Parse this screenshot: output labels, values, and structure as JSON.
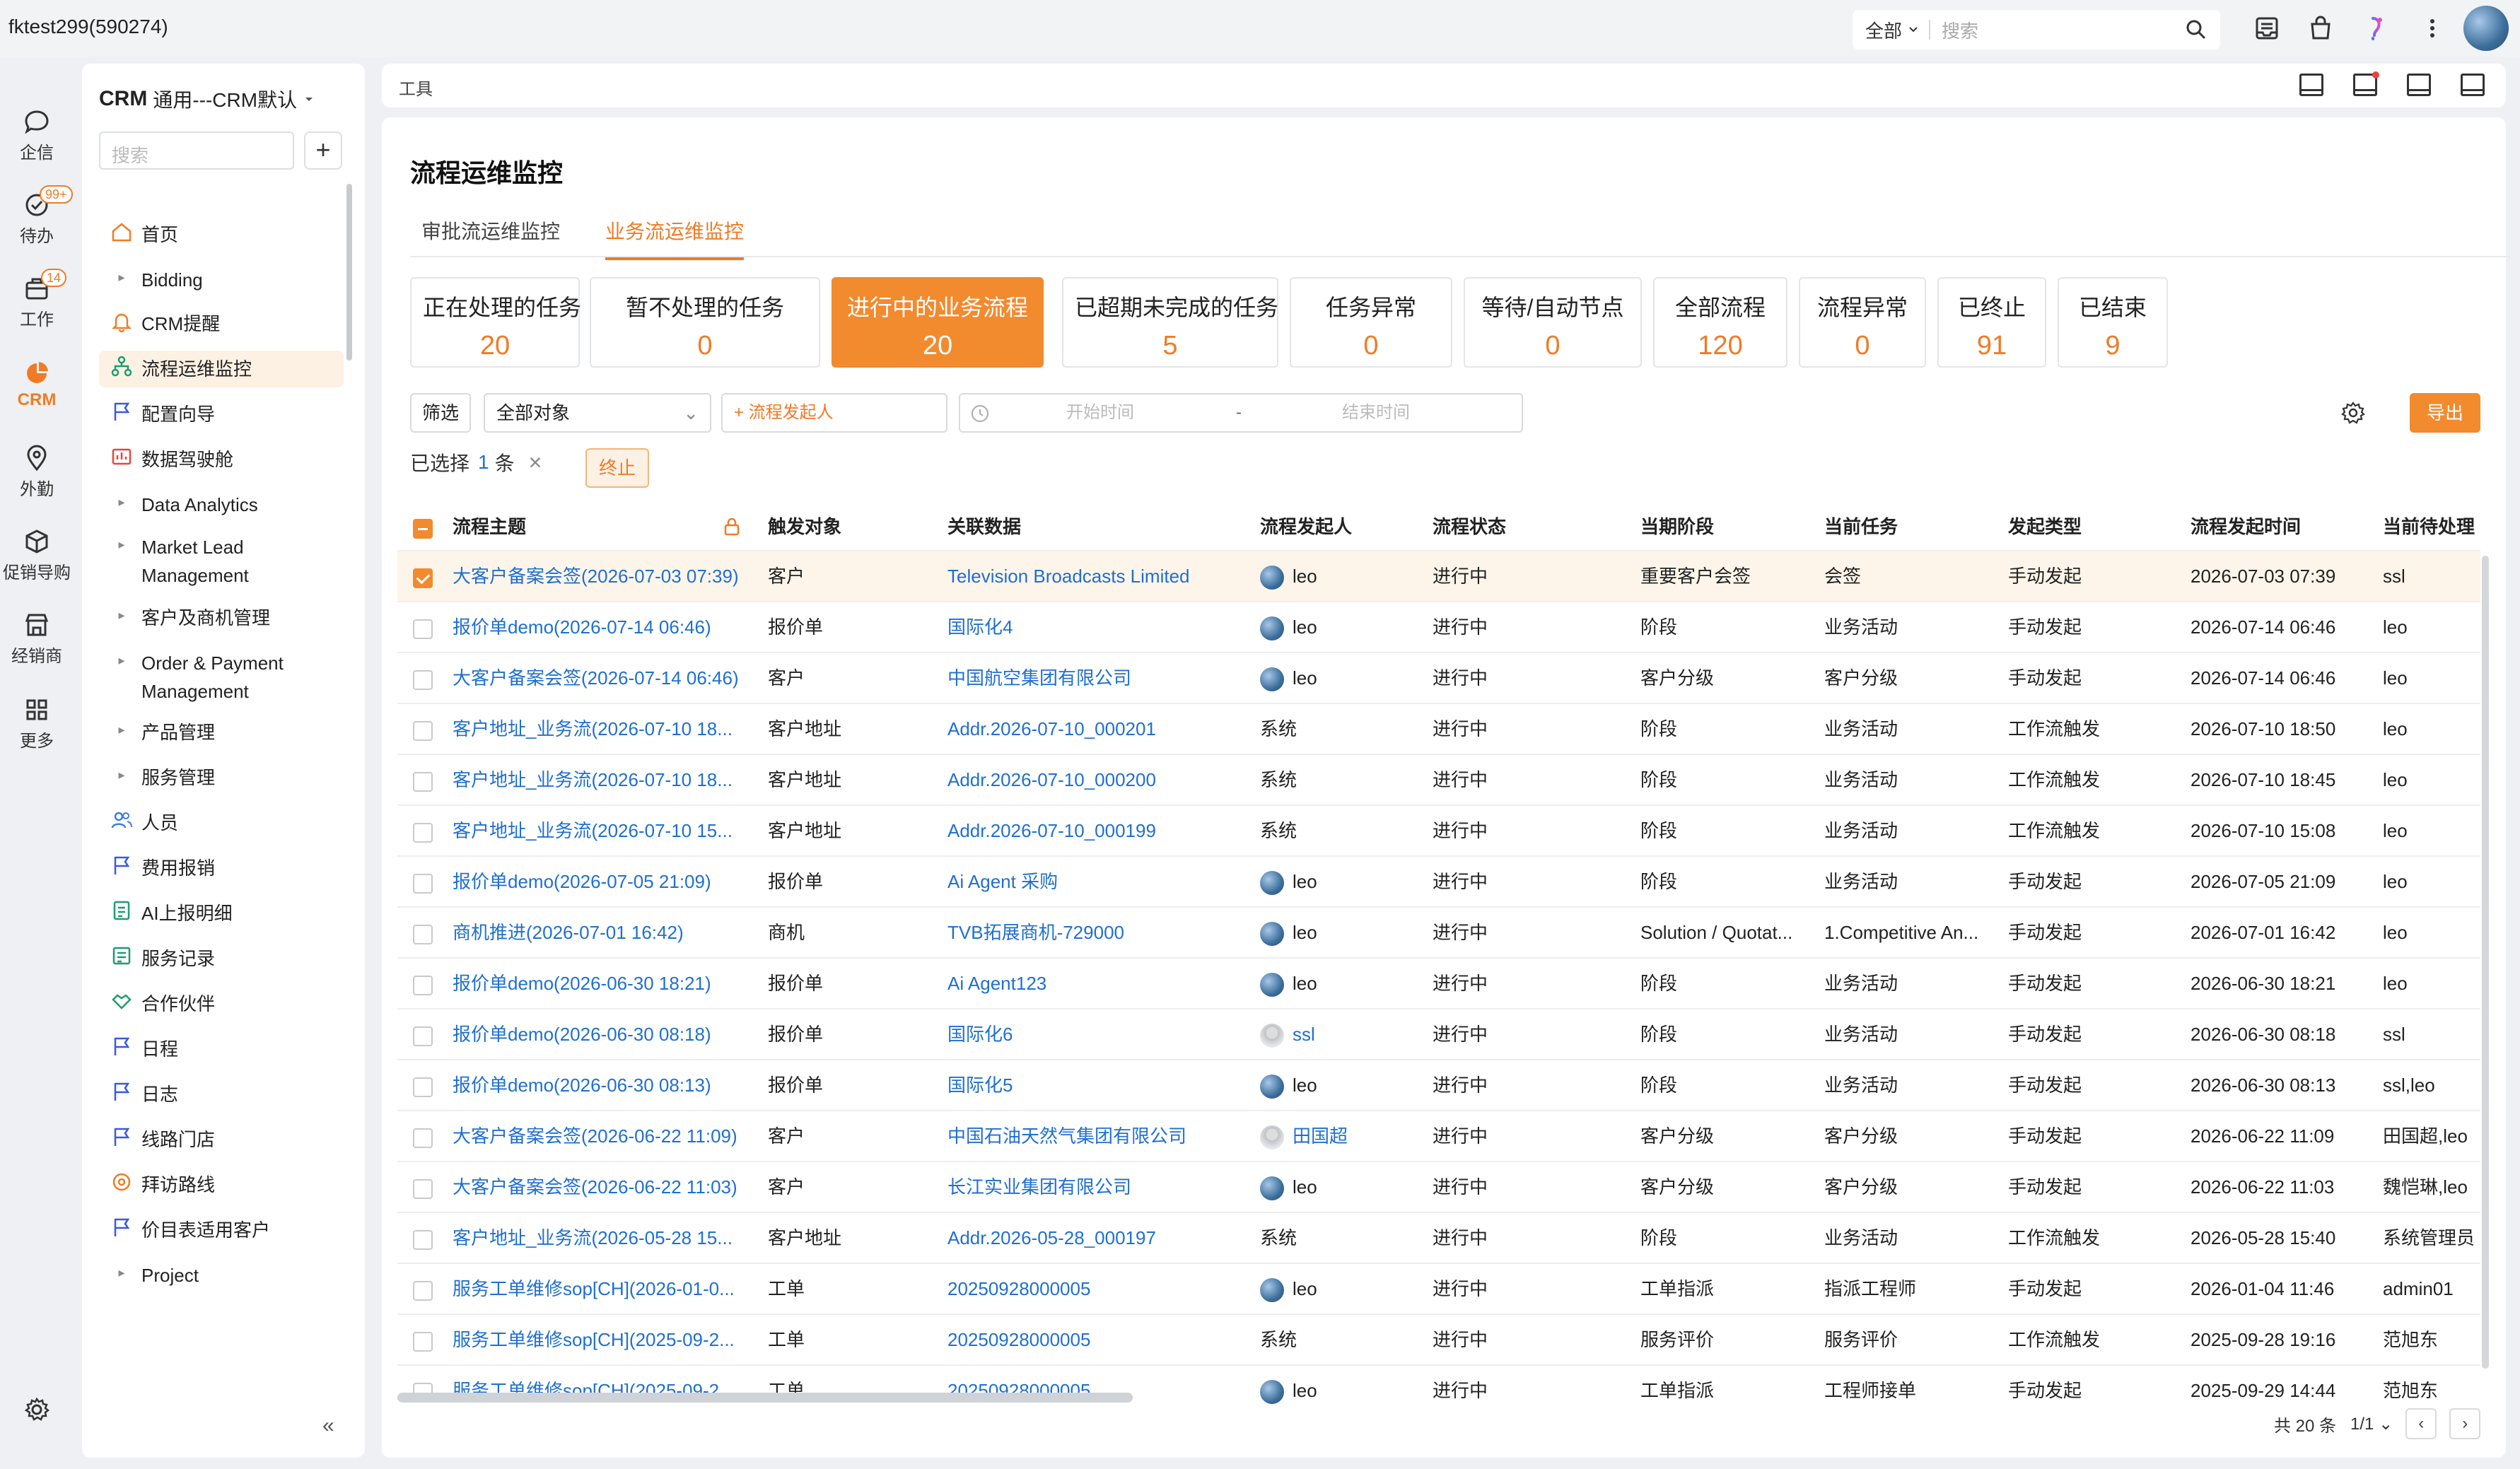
{
  "topbar": {
    "account": "fktest299(590274)",
    "search_scope": "全部",
    "search_placeholder": "搜索"
  },
  "rail": {
    "items": [
      {
        "label": "企信",
        "icon": "chat-icon"
      },
      {
        "label": "待办",
        "icon": "todo-check-icon",
        "badge": "99+"
      },
      {
        "label": "工作",
        "icon": "briefcase-icon",
        "badge": "14"
      },
      {
        "label": "CRM",
        "icon": "crm-pie-icon"
      },
      {
        "label": "外勤",
        "icon": "location-icon"
      },
      {
        "label": "促销导购",
        "icon": "box-icon"
      },
      {
        "label": "经销商",
        "icon": "store-icon"
      },
      {
        "label": "更多",
        "icon": "grid-icon"
      }
    ]
  },
  "nav": {
    "title_bold": "CRM",
    "title_rest": "通用---CRM默认",
    "search_placeholder": "搜索",
    "add_label": "+",
    "items": [
      {
        "label": "首页",
        "type": "icon",
        "icon": "home-icon"
      },
      {
        "label": "Bidding",
        "type": "group"
      },
      {
        "label": "CRM提醒",
        "type": "icon",
        "icon": "bell-icon"
      },
      {
        "label": "流程运维监控",
        "type": "icon",
        "icon": "flow-icon",
        "active": true
      },
      {
        "label": "配置向导",
        "type": "icon",
        "icon": "flag-icon"
      },
      {
        "label": "数据驾驶舱",
        "type": "icon",
        "icon": "dashboard-icon"
      },
      {
        "label": "Data Analytics",
        "type": "group"
      },
      {
        "label": "Market Lead Management",
        "type": "group"
      },
      {
        "label": "客户及商机管理",
        "type": "group"
      },
      {
        "label": "Order & Payment Management",
        "type": "group"
      },
      {
        "label": "产品管理",
        "type": "group"
      },
      {
        "label": "服务管理",
        "type": "group"
      },
      {
        "label": "人员",
        "type": "icon",
        "icon": "people-icon"
      },
      {
        "label": "费用报销",
        "type": "icon",
        "icon": "flag-icon"
      },
      {
        "label": "AI上报明细",
        "type": "icon",
        "icon": "report-icon"
      },
      {
        "label": "服务记录",
        "type": "icon",
        "icon": "record-icon"
      },
      {
        "label": "合作伙伴",
        "type": "icon",
        "icon": "handshake-icon"
      },
      {
        "label": "日程",
        "type": "icon",
        "icon": "flag-icon"
      },
      {
        "label": "日志",
        "type": "icon",
        "icon": "flag-icon"
      },
      {
        "label": "线路门店",
        "type": "icon",
        "icon": "flag-icon"
      },
      {
        "label": "拜访路线",
        "type": "icon",
        "icon": "route-icon"
      },
      {
        "label": "价目表适用客户",
        "type": "icon",
        "icon": "flag-icon"
      },
      {
        "label": "Project",
        "type": "group"
      }
    ],
    "collapse_label": "«"
  },
  "toolstrip": {
    "label": "工具"
  },
  "page": {
    "title": "流程运维监控",
    "tabs": [
      "审批流运维监控",
      "业务流运维监控"
    ],
    "active_tab": 1
  },
  "stats": [
    {
      "label": "正在处理的任务",
      "value": "20"
    },
    {
      "label": "暂不处理的任务",
      "value": "0"
    },
    {
      "label": "进行中的业务流程",
      "value": "20",
      "active": true
    },
    {
      "label": "已超期未完成的任务",
      "value": "5"
    },
    {
      "label": "任务异常",
      "value": "0"
    },
    {
      "label": "等待/自动节点",
      "value": "0"
    },
    {
      "label": "全部流程",
      "value": "120"
    },
    {
      "label": "流程异常",
      "value": "0"
    },
    {
      "label": "已终止",
      "value": "91"
    },
    {
      "label": "已结束",
      "value": "9"
    }
  ],
  "filters": {
    "filter_label": "筛选",
    "object_value": "全部对象",
    "initiator_placeholder": "+ 流程发起人",
    "start_placeholder": "开始时间",
    "range_sep": "-",
    "end_placeholder": "结束时间",
    "export_label": "导出"
  },
  "selection": {
    "prefix": "已选择",
    "count": "1",
    "suffix": "条",
    "clear": "×",
    "terminate_label": "终止"
  },
  "table": {
    "columns": [
      "流程主题",
      "触发对象",
      "关联数据",
      "流程发起人",
      "流程状态",
      "当期阶段",
      "当前任务",
      "发起类型",
      "流程发起时间",
      "当前待处理"
    ],
    "rows": [
      {
        "checked": true,
        "subject": "大客户备案会签(2026-07-03 07:39)",
        "object": "客户",
        "related": "Television Broadcasts Limited",
        "initiator": "leo",
        "avatar": "photo",
        "status": "进行中",
        "stage": "重要客户会签",
        "task": "会签",
        "type": "手动发起",
        "time": "2026-07-03 07:39",
        "pending": "ssl"
      },
      {
        "checked": false,
        "subject": "报价单demo(2026-07-14 06:46)",
        "object": "报价单",
        "related": "国际化4",
        "initiator": "leo",
        "avatar": "photo",
        "status": "进行中",
        "stage": "阶段",
        "task": "业务活动",
        "type": "手动发起",
        "time": "2026-07-14 06:46",
        "pending": "leo"
      },
      {
        "checked": false,
        "subject": "大客户备案会签(2026-07-14 06:46)",
        "object": "客户",
        "related": "中国航空集团有限公司",
        "initiator": "leo",
        "avatar": "photo",
        "status": "进行中",
        "stage": "客户分级",
        "task": "客户分级",
        "type": "手动发起",
        "time": "2026-07-14 06:46",
        "pending": "leo"
      },
      {
        "checked": false,
        "subject": "客户地址_业务流(2026-07-10 18...",
        "object": "客户地址",
        "related": "Addr.2026-07-10_000201",
        "initiator": "系统",
        "avatar": "none",
        "status": "进行中",
        "stage": "阶段",
        "task": "业务活动",
        "type": "工作流触发",
        "time": "2026-07-10 18:50",
        "pending": "leo"
      },
      {
        "checked": false,
        "subject": "客户地址_业务流(2026-07-10 18...",
        "object": "客户地址",
        "related": "Addr.2026-07-10_000200",
        "initiator": "系统",
        "avatar": "none",
        "status": "进行中",
        "stage": "阶段",
        "task": "业务活动",
        "type": "工作流触发",
        "time": "2026-07-10 18:45",
        "pending": "leo"
      },
      {
        "checked": false,
        "subject": "客户地址_业务流(2026-07-10 15...",
        "object": "客户地址",
        "related": "Addr.2026-07-10_000199",
        "initiator": "系统",
        "avatar": "none",
        "status": "进行中",
        "stage": "阶段",
        "task": "业务活动",
        "type": "工作流触发",
        "time": "2026-07-10 15:08",
        "pending": "leo"
      },
      {
        "checked": false,
        "subject": "报价单demo(2026-07-05 21:09)",
        "object": "报价单",
        "related": "Ai Agent 采购",
        "initiator": "leo",
        "avatar": "photo",
        "status": "进行中",
        "stage": "阶段",
        "task": "业务活动",
        "type": "手动发起",
        "time": "2026-07-05 21:09",
        "pending": "leo"
      },
      {
        "checked": false,
        "subject": "商机推进(2026-07-01 16:42)",
        "object": "商机",
        "related": "TVB拓展商机-729000",
        "initiator": "leo",
        "avatar": "photo",
        "status": "进行中",
        "stage": "Solution / Quotat...",
        "task": "1.Competitive An...",
        "type": "手动发起",
        "time": "2026-07-01 16:42",
        "pending": "leo"
      },
      {
        "checked": false,
        "subject": "报价单demo(2026-06-30 18:21)",
        "object": "报价单",
        "related": "Ai Agent123",
        "initiator": "leo",
        "avatar": "photo",
        "status": "进行中",
        "stage": "阶段",
        "task": "业务活动",
        "type": "手动发起",
        "time": "2026-06-30 18:21",
        "pending": "leo"
      },
      {
        "checked": false,
        "subject": "报价单demo(2026-06-30 08:18)",
        "object": "报价单",
        "related": "国际化6",
        "initiator": "ssl",
        "avatar": "gray",
        "initiator_link": true,
        "status": "进行中",
        "stage": "阶段",
        "task": "业务活动",
        "type": "手动发起",
        "time": "2026-06-30 08:18",
        "pending": "ssl"
      },
      {
        "checked": false,
        "subject": "报价单demo(2026-06-30 08:13)",
        "object": "报价单",
        "related": "国际化5",
        "initiator": "leo",
        "avatar": "photo",
        "status": "进行中",
        "stage": "阶段",
        "task": "业务活动",
        "type": "手动发起",
        "time": "2026-06-30 08:13",
        "pending": "ssl,leo"
      },
      {
        "checked": false,
        "subject": "大客户备案会签(2026-06-22 11:09)",
        "object": "客户",
        "related": "中国石油天然气集团有限公司",
        "initiator": "田国超",
        "avatar": "gray",
        "initiator_link": true,
        "status": "进行中",
        "stage": "客户分级",
        "task": "客户分级",
        "type": "手动发起",
        "time": "2026-06-22 11:09",
        "pending": "田国超,leo"
      },
      {
        "checked": false,
        "subject": "大客户备案会签(2026-06-22 11:03)",
        "object": "客户",
        "related": "长江实业集团有限公司",
        "initiator": "leo",
        "avatar": "photo",
        "status": "进行中",
        "stage": "客户分级",
        "task": "客户分级",
        "type": "手动发起",
        "time": "2026-06-22 11:03",
        "pending": "魏恺琳,leo"
      },
      {
        "checked": false,
        "subject": "客户地址_业务流(2026-05-28 15...",
        "object": "客户地址",
        "related": "Addr.2026-05-28_000197",
        "initiator": "系统",
        "avatar": "none",
        "status": "进行中",
        "stage": "阶段",
        "task": "业务活动",
        "type": "工作流触发",
        "time": "2026-05-28 15:40",
        "pending": "系统管理员"
      },
      {
        "checked": false,
        "subject": "服务工单维修sop[CH](2026-01-0...",
        "object": "工单",
        "related": "20250928000005",
        "initiator": "leo",
        "avatar": "photo",
        "status": "进行中",
        "stage": "工单指派",
        "task": "指派工程师",
        "type": "手动发起",
        "time": "2026-01-04 11:46",
        "pending": "admin01"
      },
      {
        "checked": false,
        "subject": "服务工单维修sop[CH](2025-09-2...",
        "object": "工单",
        "related": "20250928000005",
        "initiator": "系统",
        "avatar": "none",
        "status": "进行中",
        "stage": "服务评价",
        "task": "服务评价",
        "type": "工作流触发",
        "time": "2025-09-28 19:16",
        "pending": "范旭东"
      },
      {
        "checked": false,
        "subject": "服务工单维修sop[CH](2025-09-2...",
        "object": "工单",
        "related": "20250928000005",
        "initiator": "leo",
        "avatar": "photo",
        "status": "进行中",
        "stage": "工单指派",
        "task": "工程师接单",
        "type": "手动发起",
        "time": "2025-09-29 14:44",
        "pending": "范旭东"
      }
    ]
  },
  "pagination": {
    "total": "共 20 条",
    "page": "1/1",
    "prev": "‹",
    "next": "›"
  },
  "colors": {
    "accent": "#f28a2e",
    "link": "#1f6fd1"
  }
}
